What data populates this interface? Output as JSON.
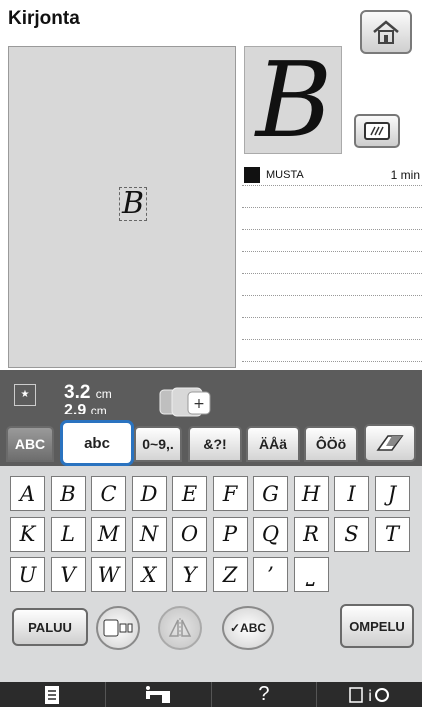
{
  "window": {
    "title": "Kirjonta"
  },
  "preview": {
    "letter": "B"
  },
  "thumbnail": {
    "letter": "B"
  },
  "colors": [
    {
      "name": "MUSTA",
      "time": "1 min",
      "swatch": "#111111"
    },
    {
      "name": "",
      "time": ""
    },
    {
      "name": "",
      "time": ""
    },
    {
      "name": "",
      "time": ""
    },
    {
      "name": "",
      "time": ""
    },
    {
      "name": "",
      "time": ""
    },
    {
      "name": "",
      "time": ""
    },
    {
      "name": "",
      "time": ""
    },
    {
      "name": "",
      "time": ""
    }
  ],
  "size": {
    "width_value": "3.2",
    "width_unit": "cm",
    "height_value": "2.9",
    "height_unit": "cm"
  },
  "tabs": [
    {
      "label": "ABC"
    },
    {
      "label": "abc"
    },
    {
      "label": "0~9,."
    },
    {
      "label": "&?!"
    },
    {
      "label": "ÄÅä"
    },
    {
      "label": "ÔÖö"
    }
  ],
  "keys": [
    "A",
    "B",
    "C",
    "D",
    "E",
    "F",
    "G",
    "H",
    "I",
    "J",
    "K",
    "L",
    "M",
    "N",
    "O",
    "P",
    "Q",
    "R",
    "S",
    "T",
    "U",
    "V",
    "W",
    "X",
    "Y",
    "Z",
    "’",
    "⎵"
  ],
  "buttons": {
    "back": "PALUU",
    "sew": "OMPELU",
    "abc_round": "ABC"
  },
  "bottom_bar": {
    "help": "?"
  },
  "accent": "#2a73c0"
}
